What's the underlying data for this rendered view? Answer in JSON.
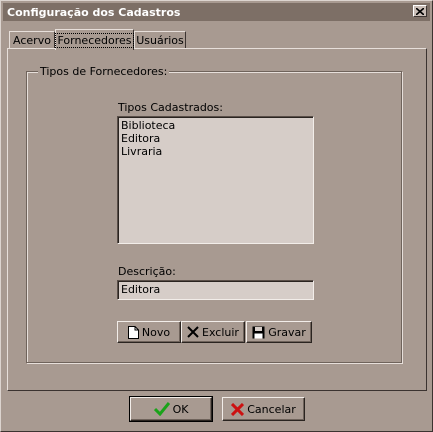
{
  "window": {
    "title": "Configuração dos Cadastros",
    "close_icon": "close-icon"
  },
  "tabs": [
    {
      "label": "Acervo",
      "active": false
    },
    {
      "label": "Fornecedores",
      "active": true
    },
    {
      "label": "Usuários",
      "active": false
    }
  ],
  "group": {
    "title": "Tipos de Fornecedores:",
    "list_label": "Tipos Cadastrados:",
    "list_items": [
      "Biblioteca",
      "Editora",
      "Livraria"
    ],
    "description_label": "Descrição:",
    "description_value": "Editora"
  },
  "actions": {
    "new_label": "Novo",
    "new_icon": "new-document-icon",
    "delete_label": "Excluir",
    "delete_icon": "x-icon",
    "save_label": "Gravar",
    "save_icon": "floppy-disk-icon"
  },
  "dialog_buttons": {
    "ok_label": "OK",
    "ok_icon": "check-icon",
    "cancel_label": "Cancelar",
    "cancel_icon": "cancel-x-icon"
  },
  "colors": {
    "window_bg": "#a89a91",
    "titlebar_bg": "#7d6f66",
    "field_bg": "#d6cdc8",
    "ok_green": "#1aa31a",
    "cancel_red": "#cc1111"
  }
}
